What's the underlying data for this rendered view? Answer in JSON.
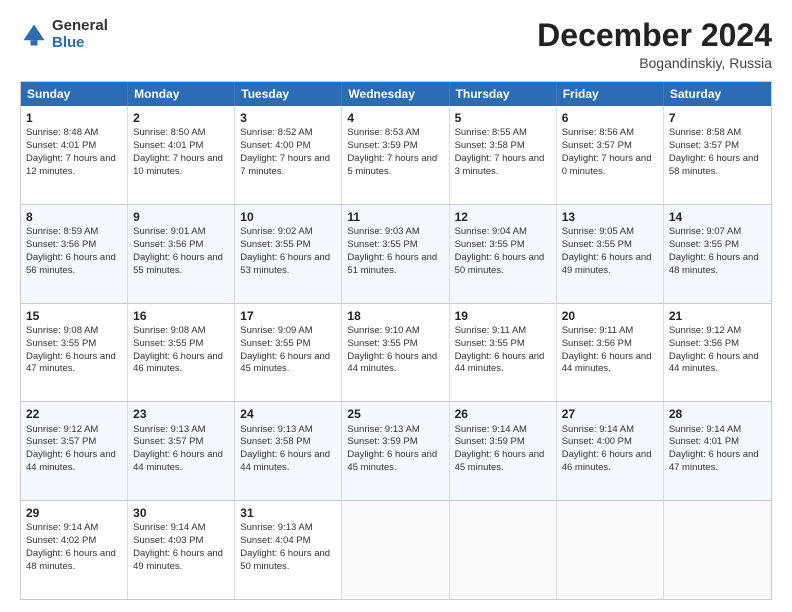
{
  "logo": {
    "general": "General",
    "blue": "Blue"
  },
  "header": {
    "month": "December 2024",
    "location": "Bogandinskiy, Russia"
  },
  "days": [
    "Sunday",
    "Monday",
    "Tuesday",
    "Wednesday",
    "Thursday",
    "Friday",
    "Saturday"
  ],
  "rows": [
    [
      {
        "day": "1",
        "sunrise": "Sunrise: 8:48 AM",
        "sunset": "Sunset: 4:01 PM",
        "daylight": "Daylight: 7 hours and 12 minutes."
      },
      {
        "day": "2",
        "sunrise": "Sunrise: 8:50 AM",
        "sunset": "Sunset: 4:01 PM",
        "daylight": "Daylight: 7 hours and 10 minutes."
      },
      {
        "day": "3",
        "sunrise": "Sunrise: 8:52 AM",
        "sunset": "Sunset: 4:00 PM",
        "daylight": "Daylight: 7 hours and 7 minutes."
      },
      {
        "day": "4",
        "sunrise": "Sunrise: 8:53 AM",
        "sunset": "Sunset: 3:59 PM",
        "daylight": "Daylight: 7 hours and 5 minutes."
      },
      {
        "day": "5",
        "sunrise": "Sunrise: 8:55 AM",
        "sunset": "Sunset: 3:58 PM",
        "daylight": "Daylight: 7 hours and 3 minutes."
      },
      {
        "day": "6",
        "sunrise": "Sunrise: 8:56 AM",
        "sunset": "Sunset: 3:57 PM",
        "daylight": "Daylight: 7 hours and 0 minutes."
      },
      {
        "day": "7",
        "sunrise": "Sunrise: 8:58 AM",
        "sunset": "Sunset: 3:57 PM",
        "daylight": "Daylight: 6 hours and 58 minutes."
      }
    ],
    [
      {
        "day": "8",
        "sunrise": "Sunrise: 8:59 AM",
        "sunset": "Sunset: 3:56 PM",
        "daylight": "Daylight: 6 hours and 56 minutes."
      },
      {
        "day": "9",
        "sunrise": "Sunrise: 9:01 AM",
        "sunset": "Sunset: 3:56 PM",
        "daylight": "Daylight: 6 hours and 55 minutes."
      },
      {
        "day": "10",
        "sunrise": "Sunrise: 9:02 AM",
        "sunset": "Sunset: 3:55 PM",
        "daylight": "Daylight: 6 hours and 53 minutes."
      },
      {
        "day": "11",
        "sunrise": "Sunrise: 9:03 AM",
        "sunset": "Sunset: 3:55 PM",
        "daylight": "Daylight: 6 hours and 51 minutes."
      },
      {
        "day": "12",
        "sunrise": "Sunrise: 9:04 AM",
        "sunset": "Sunset: 3:55 PM",
        "daylight": "Daylight: 6 hours and 50 minutes."
      },
      {
        "day": "13",
        "sunrise": "Sunrise: 9:05 AM",
        "sunset": "Sunset: 3:55 PM",
        "daylight": "Daylight: 6 hours and 49 minutes."
      },
      {
        "day": "14",
        "sunrise": "Sunrise: 9:07 AM",
        "sunset": "Sunset: 3:55 PM",
        "daylight": "Daylight: 6 hours and 48 minutes."
      }
    ],
    [
      {
        "day": "15",
        "sunrise": "Sunrise: 9:08 AM",
        "sunset": "Sunset: 3:55 PM",
        "daylight": "Daylight: 6 hours and 47 minutes."
      },
      {
        "day": "16",
        "sunrise": "Sunrise: 9:08 AM",
        "sunset": "Sunset: 3:55 PM",
        "daylight": "Daylight: 6 hours and 46 minutes."
      },
      {
        "day": "17",
        "sunrise": "Sunrise: 9:09 AM",
        "sunset": "Sunset: 3:55 PM",
        "daylight": "Daylight: 6 hours and 45 minutes."
      },
      {
        "day": "18",
        "sunrise": "Sunrise: 9:10 AM",
        "sunset": "Sunset: 3:55 PM",
        "daylight": "Daylight: 6 hours and 44 minutes."
      },
      {
        "day": "19",
        "sunrise": "Sunrise: 9:11 AM",
        "sunset": "Sunset: 3:55 PM",
        "daylight": "Daylight: 6 hours and 44 minutes."
      },
      {
        "day": "20",
        "sunrise": "Sunrise: 9:11 AM",
        "sunset": "Sunset: 3:56 PM",
        "daylight": "Daylight: 6 hours and 44 minutes."
      },
      {
        "day": "21",
        "sunrise": "Sunrise: 9:12 AM",
        "sunset": "Sunset: 3:56 PM",
        "daylight": "Daylight: 6 hours and 44 minutes."
      }
    ],
    [
      {
        "day": "22",
        "sunrise": "Sunrise: 9:12 AM",
        "sunset": "Sunset: 3:57 PM",
        "daylight": "Daylight: 6 hours and 44 minutes."
      },
      {
        "day": "23",
        "sunrise": "Sunrise: 9:13 AM",
        "sunset": "Sunset: 3:57 PM",
        "daylight": "Daylight: 6 hours and 44 minutes."
      },
      {
        "day": "24",
        "sunrise": "Sunrise: 9:13 AM",
        "sunset": "Sunset: 3:58 PM",
        "daylight": "Daylight: 6 hours and 44 minutes."
      },
      {
        "day": "25",
        "sunrise": "Sunrise: 9:13 AM",
        "sunset": "Sunset: 3:59 PM",
        "daylight": "Daylight: 6 hours and 45 minutes."
      },
      {
        "day": "26",
        "sunrise": "Sunrise: 9:14 AM",
        "sunset": "Sunset: 3:59 PM",
        "daylight": "Daylight: 6 hours and 45 minutes."
      },
      {
        "day": "27",
        "sunrise": "Sunrise: 9:14 AM",
        "sunset": "Sunset: 4:00 PM",
        "daylight": "Daylight: 6 hours and 46 minutes."
      },
      {
        "day": "28",
        "sunrise": "Sunrise: 9:14 AM",
        "sunset": "Sunset: 4:01 PM",
        "daylight": "Daylight: 6 hours and 47 minutes."
      }
    ],
    [
      {
        "day": "29",
        "sunrise": "Sunrise: 9:14 AM",
        "sunset": "Sunset: 4:02 PM",
        "daylight": "Daylight: 6 hours and 48 minutes."
      },
      {
        "day": "30",
        "sunrise": "Sunrise: 9:14 AM",
        "sunset": "Sunset: 4:03 PM",
        "daylight": "Daylight: 6 hours and 49 minutes."
      },
      {
        "day": "31",
        "sunrise": "Sunrise: 9:13 AM",
        "sunset": "Sunset: 4:04 PM",
        "daylight": "Daylight: 6 hours and 50 minutes."
      },
      null,
      null,
      null,
      null
    ]
  ]
}
